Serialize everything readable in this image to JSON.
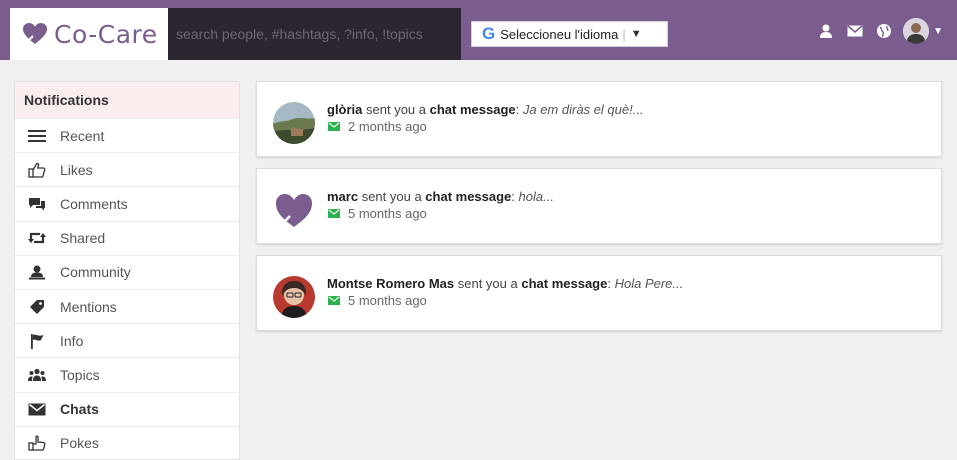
{
  "app": {
    "name": "Co-Care"
  },
  "header": {
    "search_placeholder": "search people, #hashtags, ?info, !topics",
    "translate": {
      "g_letter": "G",
      "label": "Seleccioneu l'idioma",
      "caret": "▼"
    },
    "icons": [
      "user-icon",
      "mail-icon",
      "globe-icon",
      "avatar",
      "caret-down-icon"
    ]
  },
  "sidebar": {
    "title": "Notifications",
    "items": [
      {
        "label": "Recent",
        "icon": "list-icon"
      },
      {
        "label": "Likes",
        "icon": "thumbs-up-icon"
      },
      {
        "label": "Comments",
        "icon": "comments-icon"
      },
      {
        "label": "Shared",
        "icon": "retweet-icon"
      },
      {
        "label": "Community",
        "icon": "community-icon"
      },
      {
        "label": "Mentions",
        "icon": "tag-icon"
      },
      {
        "label": "Info",
        "icon": "flag-icon"
      },
      {
        "label": "Topics",
        "icon": "group-icon"
      },
      {
        "label": "Chats",
        "icon": "envelope-icon",
        "active": true
      },
      {
        "label": "Pokes",
        "icon": "poke-icon"
      }
    ]
  },
  "notifications": [
    {
      "user": "glòria",
      "text": " sent you a ",
      "action": "chat message",
      "colon": ": ",
      "preview": "Ja em diràs el què!...",
      "time": "2 months ago"
    },
    {
      "user": "marc",
      "text": " sent you a ",
      "action": "chat message",
      "colon": ": ",
      "preview": "hola...",
      "time": "5 months ago"
    },
    {
      "user": "Montse Romero Mas",
      "text": " sent you a ",
      "action": "chat message",
      "colon": ": ",
      "preview": "Hola Pere...",
      "time": "5 months ago"
    }
  ],
  "colors": {
    "brand": "#7b5c8f",
    "search_bg": "#2c2630",
    "unread_green": "#2bb24c",
    "sidebar_head_bg": "#fbeded"
  }
}
